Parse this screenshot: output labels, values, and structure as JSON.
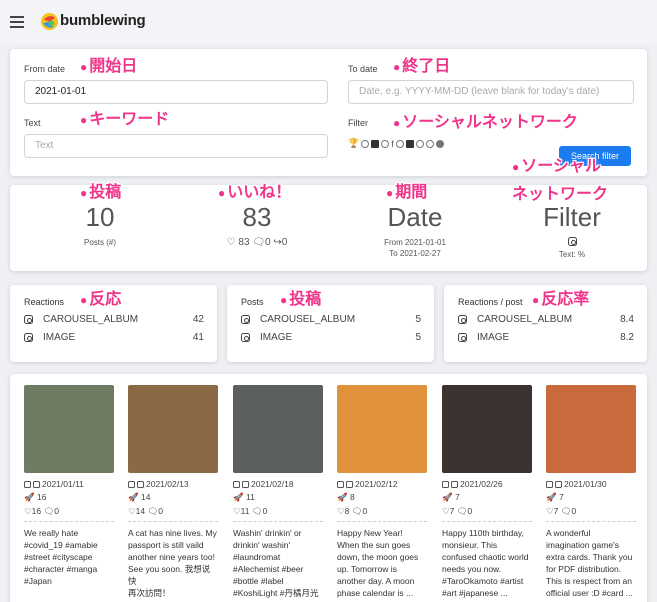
{
  "app": {
    "brand": "bumblewing"
  },
  "form": {
    "from_label": "From date",
    "from_value": "2021-01-01",
    "to_label": "To date",
    "to_placeholder": "Date, e.g. YYYY-MM-DD (leave blank for today's date)",
    "text_label": "Text",
    "text_placeholder": "Text",
    "filter_label": "Filter",
    "search_button": "Search filter"
  },
  "annotations": {
    "from": "開始日",
    "to": "終了日",
    "text": "キーワード",
    "filter": "ソーシャルネットワーク",
    "filter2_line1": "ソーシャル",
    "filter2_line2": "ネットワーク",
    "posts": "投稿",
    "likes": "いいね！",
    "period": "期間",
    "reactions": "反応",
    "posts2": "投稿",
    "rate": "反応率"
  },
  "stats": {
    "posts": {
      "value": "10",
      "label": "Posts (#)"
    },
    "likes": {
      "value": "83",
      "likes": "83",
      "comments": "0",
      "shares": "0"
    },
    "date": {
      "value": "Date",
      "from": "From 2021-01-01",
      "to": "To 2021-02-27"
    },
    "filter": {
      "value": "Filter",
      "label": "Text: %"
    }
  },
  "breakdowns": {
    "reactions": {
      "title": "Reactions",
      "rows": [
        {
          "name": "CAROUSEL_ALBUM",
          "value": "42"
        },
        {
          "name": "IMAGE",
          "value": "41"
        }
      ]
    },
    "posts": {
      "title": "Posts",
      "rows": [
        {
          "name": "CAROUSEL_ALBUM",
          "value": "5"
        },
        {
          "name": "IMAGE",
          "value": "5"
        }
      ]
    },
    "rate": {
      "title": "Reactions / post",
      "rows": [
        {
          "name": "CAROUSEL_ALBUM",
          "value": "8.4"
        },
        {
          "name": "IMAGE",
          "value": "8.2"
        }
      ]
    }
  },
  "posts": [
    {
      "date": "2021/01/11",
      "reach": "16",
      "likes": "16",
      "comments": "0",
      "text": "We really hate\n#covid_19 #amabie\n#street #cityscape\n#character #manga\n#Japan",
      "color": "#6f7c63"
    },
    {
      "date": "2021/02/13",
      "reach": "14",
      "likes": "14",
      "comments": "0",
      "text": "A cat has nine lives. My\npassport is still vaild\nanother nine years too!\nSee you soon. 我想说快\n再次訪問！\n#HappyNewYear ...",
      "color": "#8a6a45"
    },
    {
      "date": "2021/02/18",
      "reach": "11",
      "likes": "11",
      "comments": "0",
      "text": "Washin' drinkin' or\ndrinkin' washin'\n#laundromat\n#Alechemist #beer\n#bottle #label\n#KoshiLight #丹橘月光",
      "color": "#5b5f5e"
    },
    {
      "date": "2021/02/12",
      "reach": "8",
      "likes": "8",
      "comments": "0",
      "text": "Happy New Year!\nWhen the sun goes\ndown, the moon goes\nup. Tomorrow is\nanother day. A moon\nphase calendar is ...",
      "color": "#e0923a"
    },
    {
      "date": "2021/02/26",
      "reach": "7",
      "likes": "7",
      "comments": "0",
      "text": "Happy 110th birthday,\nmonsieur. This\nconfused chaotic world\nneeds you now.\n#TaroOkamoto #artist\n#art #japanese ...",
      "color": "#3a3330"
    },
    {
      "date": "2021/01/30",
      "reach": "7",
      "likes": "7",
      "comments": "0",
      "text": "A wonderful\nimagination game's\nextra cards. Thank you\nfor PDF distribution.\nThis is respect from an\nofficial user :D #card ...",
      "color": "#c96a3c"
    }
  ]
}
